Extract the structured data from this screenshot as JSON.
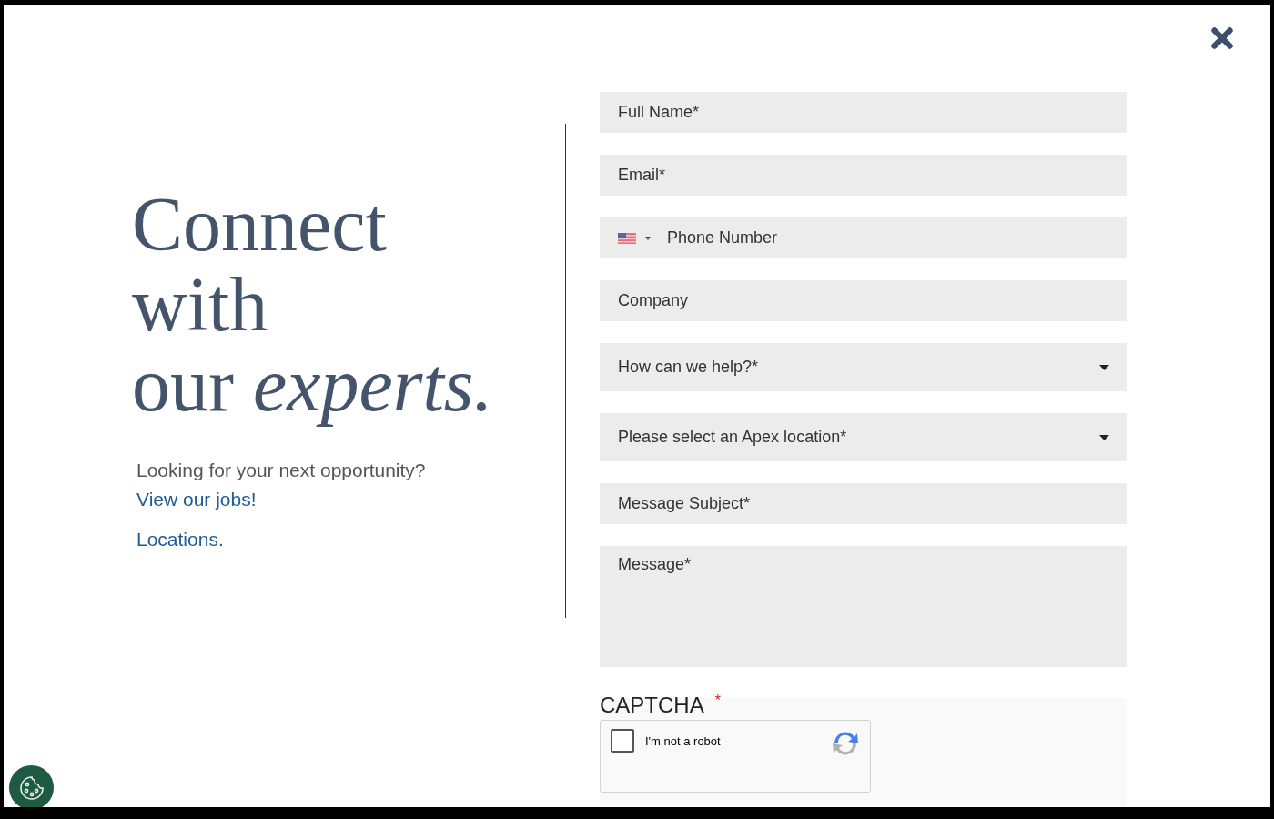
{
  "heading": {
    "lines": [
      "Connect",
      "with",
      "our *experts.*"
    ]
  },
  "intro": "Looking for your next opportunity?",
  "links": [
    "View our jobs!",
    "Locations."
  ],
  "fields": [
    {
      "kind": "text",
      "placeholder": "Full Name*"
    },
    {
      "kind": "text",
      "placeholder": "Email*"
    },
    {
      "kind": "phone",
      "placeholder": "Phone Number"
    },
    {
      "kind": "text",
      "placeholder": "Company"
    },
    {
      "kind": "select",
      "placeholder": "How can we help?*"
    },
    {
      "kind": "select",
      "placeholder": "Please select an Apex location*"
    },
    {
      "kind": "text",
      "placeholder": "Message Subject*"
    },
    {
      "kind": "textarea",
      "placeholder": "Message*"
    }
  ],
  "captcha": {
    "label": "CAPTCHA",
    "required_mark": "*",
    "checkbox_label": "I'm not a robot",
    "checked": false
  }
}
